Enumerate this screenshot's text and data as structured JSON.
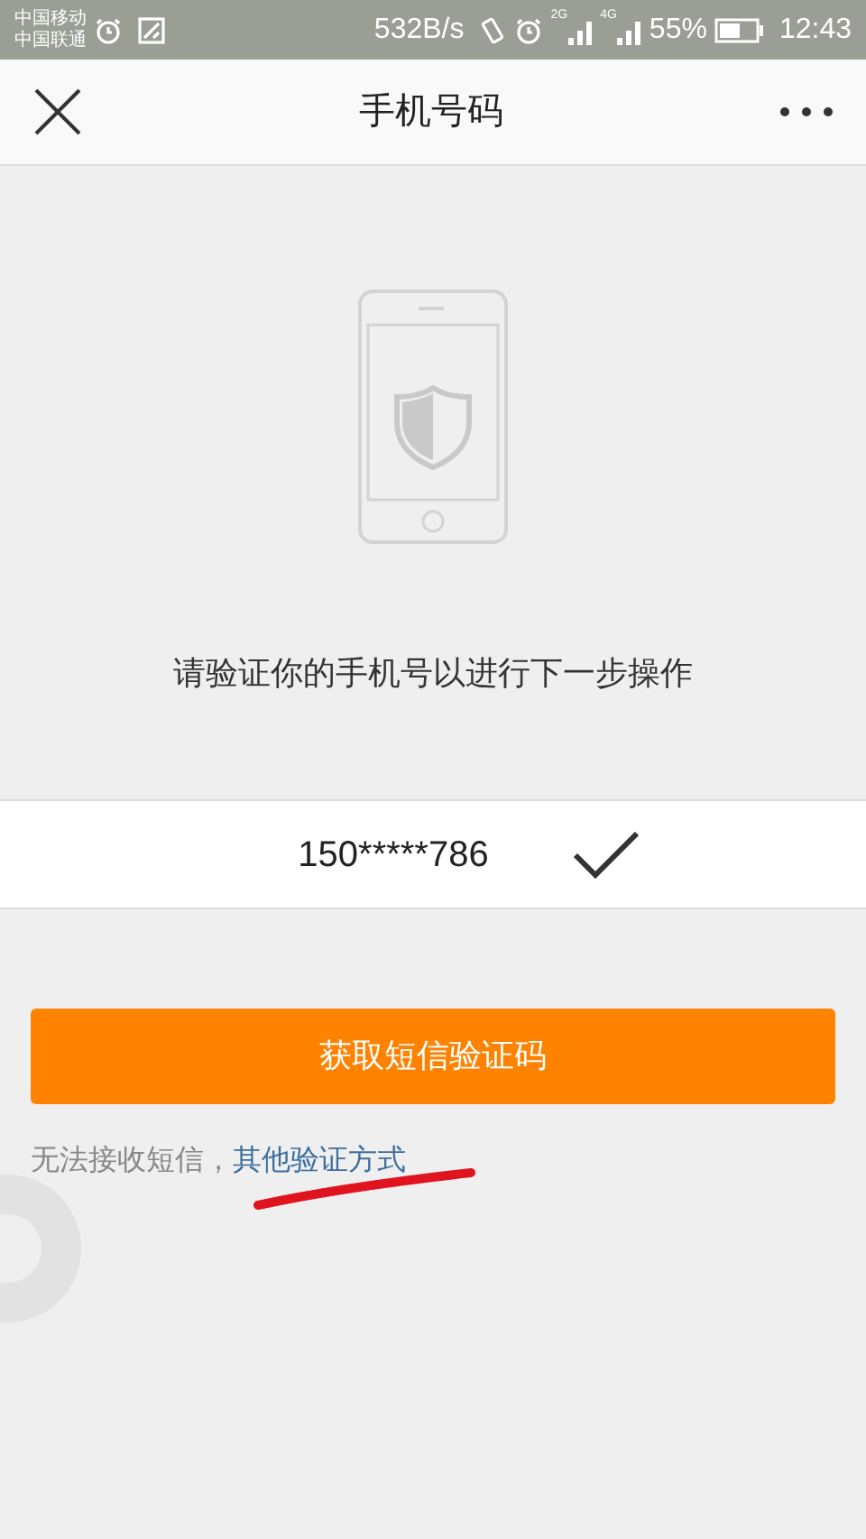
{
  "status_bar": {
    "carrier_1": "中国移动",
    "carrier_2": "中国联通",
    "speed": "532B/s",
    "network_1": "2G",
    "network_2": "4G",
    "battery": "55%",
    "time": "12:43"
  },
  "nav": {
    "title": "手机号码"
  },
  "prompt": "请验证你的手机号以进行下一步操作",
  "phone": {
    "number": "150*****786",
    "verified": true
  },
  "button": "获取短信验证码",
  "footer": {
    "text": "无法接收短信，",
    "link": "其他验证方式"
  }
}
